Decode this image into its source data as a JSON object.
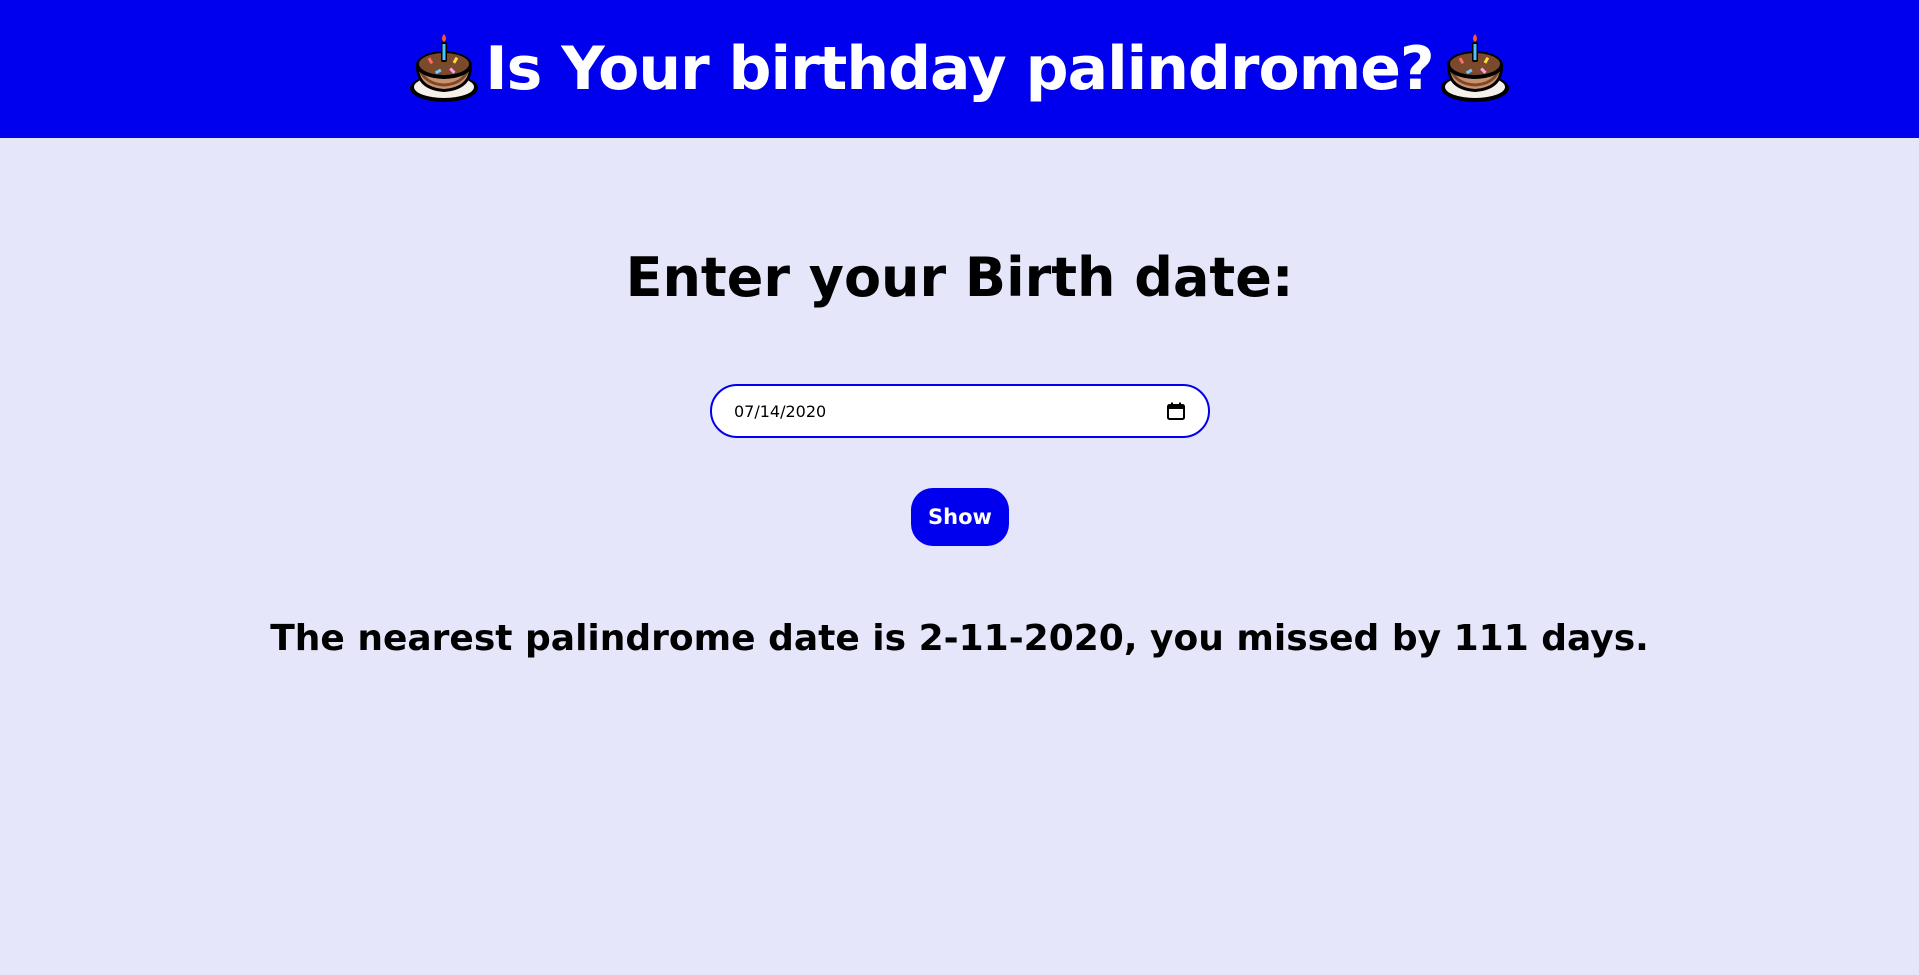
{
  "header": {
    "title": "Is Your birthday palindrome?",
    "left_icon": "birthday-cake-icon",
    "right_icon": "birthday-cake-icon",
    "background_color": "#0000ee"
  },
  "form": {
    "prompt": "Enter your Birth date:",
    "date_value": "07/14/2020",
    "calendar_icon": "calendar-icon",
    "show_label": "Show"
  },
  "result": {
    "message": "The nearest palindrome date is 2-11-2020, you missed by 111 days."
  },
  "colors": {
    "accent": "#0000ee",
    "page_background": "#e6e6fb"
  }
}
